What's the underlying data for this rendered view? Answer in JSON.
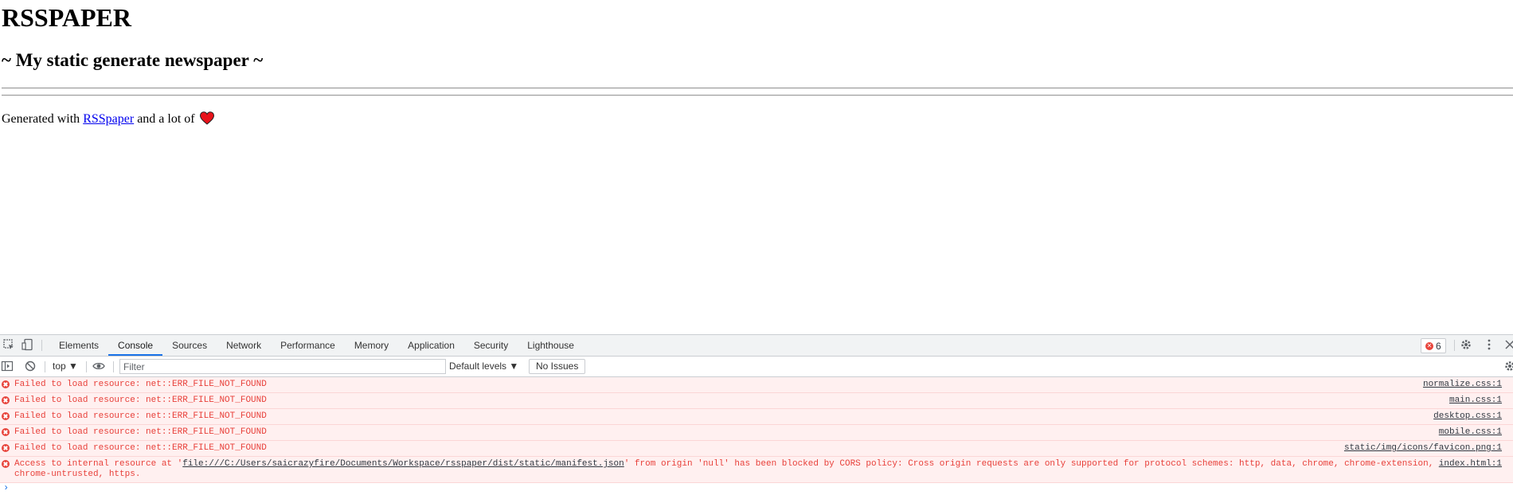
{
  "page": {
    "title": "RSSPAPER",
    "subtitle": "~ My static generate newspaper ~",
    "footer_prefix": "Generated with ",
    "footer_link": "RSSpaper",
    "footer_suffix": " and a lot of ",
    "heart_color": "#e8131b"
  },
  "devtools": {
    "tabs": [
      "Elements",
      "Console",
      "Sources",
      "Network",
      "Performance",
      "Memory",
      "Application",
      "Security",
      "Lighthouse"
    ],
    "active_tab": "Console",
    "error_count": "6",
    "toolbar": {
      "context": "top",
      "filter_placeholder": "Filter",
      "levels": "Default levels",
      "issues": "No Issues"
    },
    "messages": [
      {
        "text": "Failed to load resource: net::ERR_FILE_NOT_FOUND",
        "source": "normalize.css:1"
      },
      {
        "text": "Failed to load resource: net::ERR_FILE_NOT_FOUND",
        "source": "main.css:1"
      },
      {
        "text": "Failed to load resource: net::ERR_FILE_NOT_FOUND",
        "source": "desktop.css:1"
      },
      {
        "text": "Failed to load resource: net::ERR_FILE_NOT_FOUND",
        "source": "mobile.css:1"
      },
      {
        "text": "Failed to load resource: net::ERR_FILE_NOT_FOUND",
        "source": "static/img/icons/favicon.png:1"
      }
    ],
    "cors_message": {
      "prefix": "Access to internal resource at '",
      "url": "file:///C:/Users/saicrazyfire/Documents/Workspace/rsspaper/dist/static/manifest.json",
      "suffix": "' from origin 'null' has been blocked by CORS policy: Cross origin requests are only supported for protocol schemes: http, data, chrome, chrome-extension, chrome-untrusted, https.",
      "source": "index.html:1"
    },
    "colors": {
      "error": "#e8403a",
      "error_bg": "#fff0f0",
      "accent": "#1a73e8"
    }
  }
}
